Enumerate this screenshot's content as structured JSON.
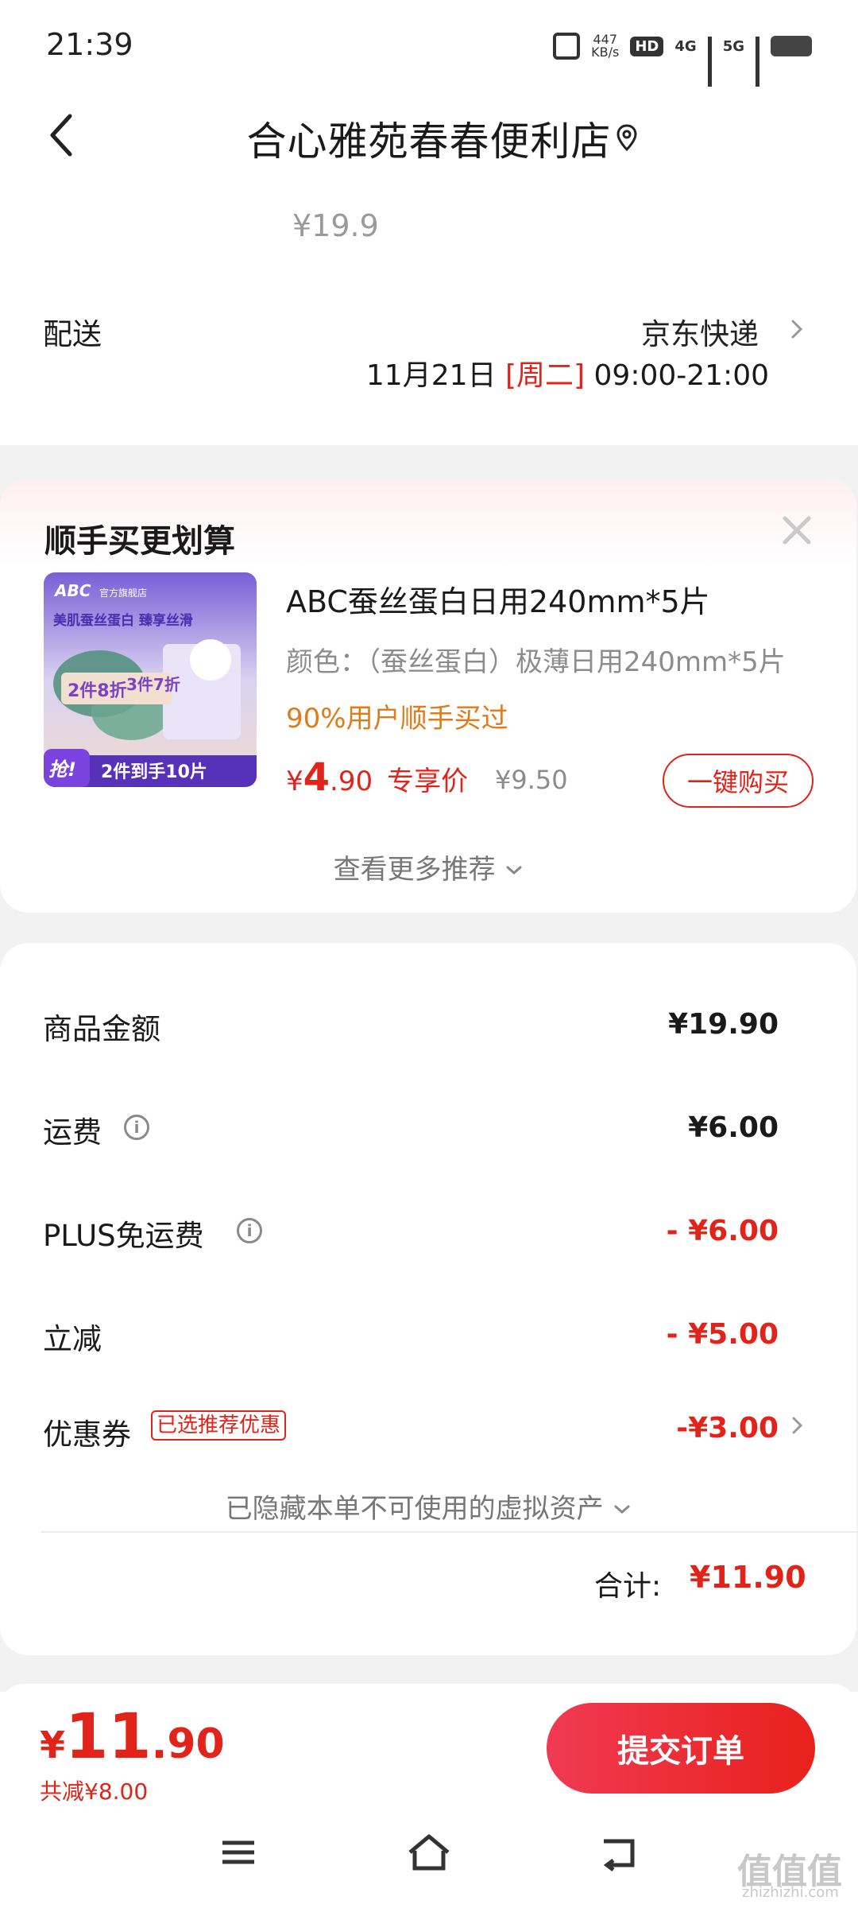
{
  "status_bar": {
    "time": "21:39",
    "net_speed_value": "447",
    "net_speed_unit": "KB/s",
    "hd_label": "HD",
    "sim1_label": "4G",
    "sim2_label": "5G"
  },
  "header": {
    "title": "合心雅苑春春便利店"
  },
  "product_top": {
    "price": "¥19.9"
  },
  "delivery": {
    "label": "配送",
    "method": "京东快递",
    "date": "11月21日",
    "weekday": "[周二]",
    "time_range": "09:00-21:00"
  },
  "recommendation": {
    "title": "顺手买更划算",
    "product": {
      "name": "ABC蚕丝蛋白日用240mm*5片",
      "spec": "颜色：（蚕丝蛋白）极薄日用240mm*5片",
      "social_proof": "90%用户顺手买过",
      "price_currency": "¥",
      "price_int": "4",
      "price_dec": ".90",
      "price_label": "专享价",
      "original_price": "¥9.50",
      "buy_label": "一键购买",
      "image": {
        "brand": "ABC",
        "badge": "官方旗舰店",
        "headline": "美肌蚕丝蛋白 臻享丝滑",
        "promo1": "2件8折",
        "promo2": "3件7折",
        "grab": "抢!",
        "banner": "2件到手10片"
      }
    },
    "more_label": "查看更多推荐"
  },
  "summary": {
    "rows": [
      {
        "label": "商品金额",
        "value": "¥19.90"
      },
      {
        "label": "运费",
        "value": "¥6.00"
      },
      {
        "label": "PLUS免运费",
        "value": "- ¥6.00"
      },
      {
        "label": "立减",
        "value": "- ¥5.00"
      },
      {
        "label": "优惠券",
        "value": "-¥3.00",
        "tag": "已选推荐优惠"
      }
    ],
    "hidden_assets_label": "已隐藏本单不可使用的虚拟资产",
    "total_label": "合计:",
    "total_value": "¥11.90"
  },
  "bottom": {
    "currency": "¥",
    "price_int": "11",
    "price_dec": ".90",
    "saved": "共减¥8.00",
    "submit_label": "提交订单"
  },
  "watermark": {
    "main": "值值值",
    "sub": "zhizhizhi.com"
  },
  "colors": {
    "accent_red": "#e2231a",
    "orange": "#e07b1a",
    "muted": "#8c8c8c",
    "background": "#f2f2f2"
  }
}
